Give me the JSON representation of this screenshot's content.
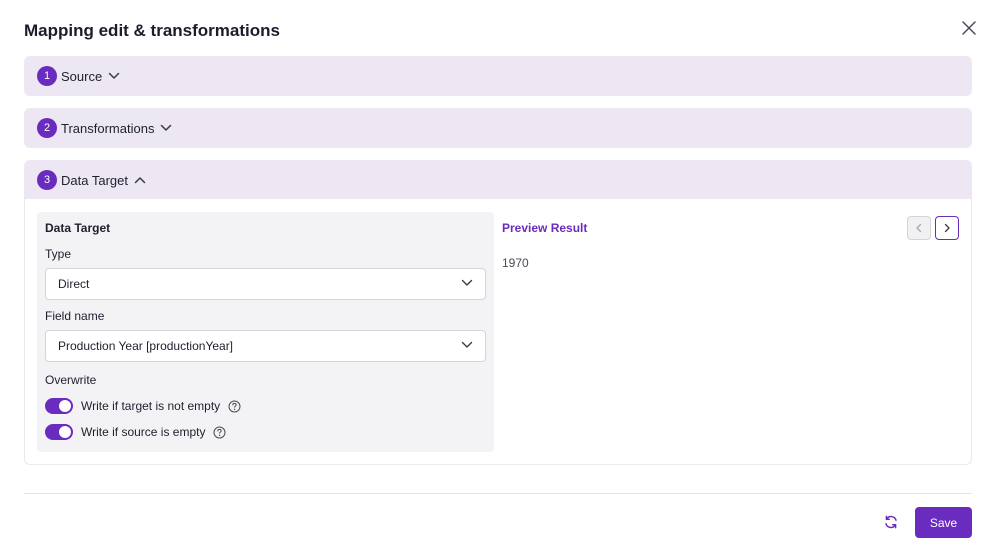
{
  "dialog": {
    "title": "Mapping edit & transformations",
    "close_icon": "close-icon"
  },
  "sections": [
    {
      "step": "1",
      "label": "Source",
      "expanded": false
    },
    {
      "step": "2",
      "label": "Transformations",
      "expanded": false
    },
    {
      "step": "3",
      "label": "Data Target",
      "expanded": true
    }
  ],
  "data_target": {
    "panel_title": "Data Target",
    "type_label": "Type",
    "type_value": "Direct",
    "field_label": "Field name",
    "field_value": "Production Year [productionYear]",
    "overwrite_label": "Overwrite",
    "toggles": [
      {
        "label": "Write if target is not empty",
        "on": true
      },
      {
        "label": "Write if source is empty",
        "on": true
      }
    ]
  },
  "preview": {
    "title": "Preview Result",
    "value": "1970"
  },
  "footer": {
    "save_label": "Save",
    "reset_icon": "refresh-icon"
  },
  "colors": {
    "accent": "#6a2bbf",
    "section_bg": "#ede7f4",
    "panel_bg": "#f3f2f5"
  }
}
